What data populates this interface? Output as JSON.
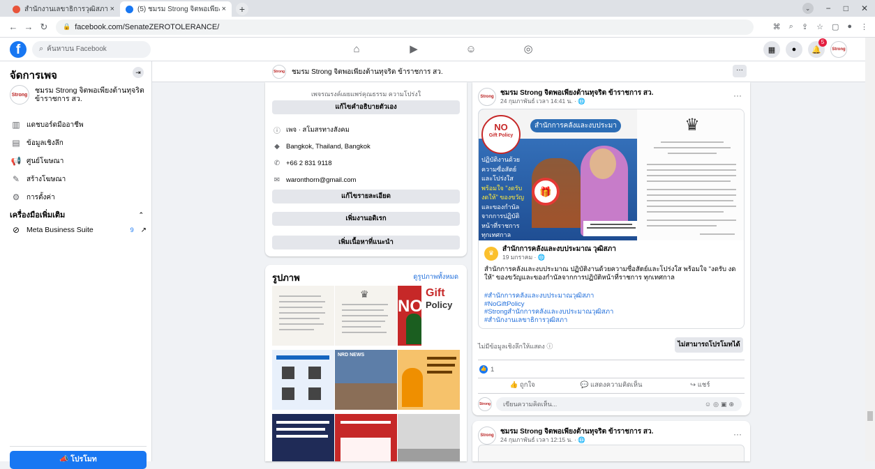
{
  "browser": {
    "tabs": [
      {
        "label": "สำนักงานเลขาธิการวุฒิสภา",
        "close": "×"
      },
      {
        "label": "(5) ชมรม Strong จิตพอเพียงต้านทุจริ",
        "close": "×"
      }
    ],
    "new_tab": "+",
    "url": "facebook.com/SenateZEROTOLERANCE/"
  },
  "fb": {
    "search_placeholder": "ค้นหาบน Facebook",
    "notification_count": "5"
  },
  "sidebar": {
    "title": "จัดการเพจ",
    "page_name": "ชมรม Strong จิตพอเพียงต้านทุจริต ข้าราชการ สว.",
    "menu": [
      {
        "label": "แดชบอร์ดมืออาชีพ",
        "icon": "dashboard-icon"
      },
      {
        "label": "ข้อมูลเชิงลึก",
        "icon": "insights-icon"
      },
      {
        "label": "ศูนย์โฆษณา",
        "icon": "megaphone-icon"
      },
      {
        "label": "สร้างโฆษณา",
        "icon": "edit-icon"
      },
      {
        "label": "การตั้งค่า",
        "icon": "gear-icon"
      }
    ],
    "tools_label": "เครื่องมือเพิ่มเติม",
    "meta_business_suite": {
      "label": "Meta Business Suite",
      "count": "9"
    },
    "promote_label": "โปรโมท"
  },
  "topbar": {
    "page_name": "ชมรม Strong จิตพอเพียงต้านทุจริต ข้าราชการ สว.",
    "more": "···"
  },
  "about": {
    "blurb": "เพจรณรงค์เผยแพร่คุณธรรม ความโปร่งใ",
    "edit_bio": "แก้ไขคำอธิบายตัวเอง",
    "category": "เพจ · สโมสรทางสังคม",
    "address": "Bangkok, Thailand, Bangkok",
    "phone": "+66 2 831 9118",
    "email": "waronthorn@gmail.com",
    "edit_details": "แก้ไขรายละเอียด",
    "add_featured": "เพิ่มงานอดิเรก",
    "add_featured_content": "เพิ่มเนื้อหาที่แนะนำ"
  },
  "photos": {
    "title": "รูปภาพ",
    "see_all": "ดูรูปภาพทั้งหมด",
    "gift_title": "Gift",
    "gift_sub": "Policy",
    "no_text": "NO",
    "news_label": "NRD NEWS"
  },
  "post": {
    "author": "ชมรม Strong จิตพอเพียงต้านทุจริต ข้าราชการ สว.",
    "time": "24 กุมภาพันธ์ เวลา 14:41 น. · ",
    "banner_no": "NO",
    "banner_policy": "Gift Policy",
    "banner_heading": "สำนักการคลังและงบประมา",
    "banner_lines": [
      "ปฏิบัติงานด้วย",
      "ความซื่อสัตย์",
      "และโปร่งใส",
      "พร้อมใจ \"งดรับ",
      "งดให้\" ของขวัญ",
      "และของกำนัล",
      "จากการปฏิบัติ",
      "หน้าที่ราชการ",
      "ทุกเทศกาล"
    ],
    "shared_author": "สำนักการคลังและงบประมาณ วุฒิสภา",
    "shared_time": "19 มกราคม · ",
    "shared_body": "สำนักการคลังและงบประมาณ ปฏิบัติงานด้วยความซื่อสัตย์และโปร่งใส พร้อมใจ \"งดรับ งดให้\" ของขวัญและของกำนัลจากการปฏิบัติหน้าที่ราชการ ทุกเทศกาล",
    "hashtags": [
      "#สำนักการคลังและงบประมาณวุฒิสภา",
      "#NoGiftPolicy",
      "#Strongสำนักการคลังและงบประมาณวุฒิสภา",
      "#สำนักงานเลขาธิการวุฒิสภา"
    ],
    "insights_note": "ไม่มีข้อมูลเชิงลึกให้แสดง",
    "boost_label": "ไม่สามารถโปรโมทได้",
    "reaction_count": "1",
    "actions": [
      "ถูกใจ",
      "แสดงความคิดเห็น",
      "แชร์"
    ],
    "comment_placeholder": "เขียนความคิดเห็น..."
  },
  "post2": {
    "author": "ชมรม Strong จิตพอเพียงต้านทุจริต ข้าราชการ สว.",
    "time": "24 กุมภาพันธ์ เวลา 12:15 น. · "
  },
  "colors": {
    "brand": "#1877f2",
    "badge": "#e41e3f",
    "link": "#216fdb"
  }
}
